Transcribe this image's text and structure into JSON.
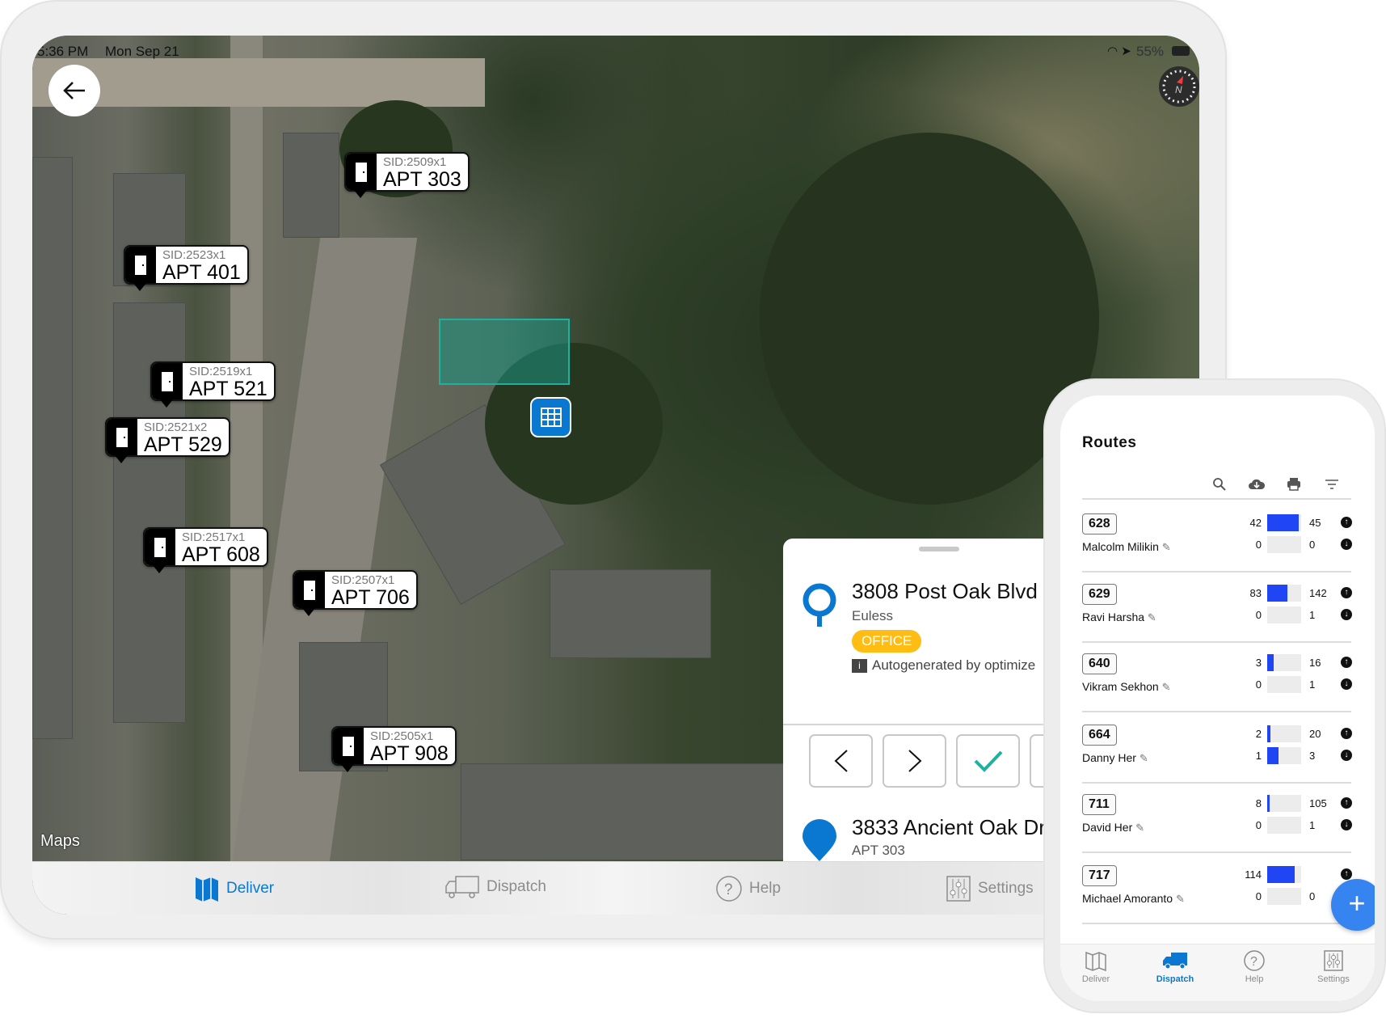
{
  "status_bar": {
    "time": "5:36 PM",
    "date": "Mon Sep 21",
    "battery": "55%"
  },
  "map": {
    "attribution": "Maps",
    "markers": [
      {
        "sid": "SID:2509x1",
        "apt": "APT 303"
      },
      {
        "sid": "SID:2523x1",
        "apt": "APT 401"
      },
      {
        "sid": "SID:2519x1",
        "apt": "APT 521"
      },
      {
        "sid": "SID:2521x2",
        "apt": "APT 529"
      },
      {
        "sid": "SID:2517x1",
        "apt": "APT 608"
      },
      {
        "sid": "SID:2507x1",
        "apt": "APT 706"
      },
      {
        "sid": "SID:2505x1",
        "apt": "APT 908"
      }
    ]
  },
  "sheet": {
    "stops": [
      {
        "title": "3808 Post Oak Blvd",
        "subtitle": "Euless",
        "tag": "OFFICE",
        "note": "Autogenerated by optimize"
      },
      {
        "title": "3833 Ancient Oak Dr",
        "subtitle": "APT 303"
      }
    ]
  },
  "tablet_nav": {
    "items": [
      {
        "label": "Deliver",
        "active": true
      },
      {
        "label": "Dispatch"
      },
      {
        "label": "Help"
      },
      {
        "label": "Settings"
      }
    ]
  },
  "phone": {
    "title": "Routes",
    "toolbar": [
      "search-icon",
      "cloud-download-icon",
      "print-icon",
      "filter-icon"
    ],
    "routes": [
      {
        "id": "628",
        "driver": "Malcolm Milikin",
        "up_done": 42,
        "up_total": 45,
        "down_done": 0,
        "down_total": 0
      },
      {
        "id": "629",
        "driver": "Ravi Harsha",
        "up_done": 83,
        "up_total": 142,
        "down_done": 0,
        "down_total": 1
      },
      {
        "id": "640",
        "driver": "Vikram Sekhon",
        "up_done": 3,
        "up_total": 16,
        "down_done": 0,
        "down_total": 1
      },
      {
        "id": "664",
        "driver": "Danny Her",
        "up_done": 2,
        "up_total": 20,
        "down_done": 1,
        "down_total": 3
      },
      {
        "id": "711",
        "driver": "David Her",
        "up_done": 8,
        "up_total": 105,
        "down_done": 0,
        "down_total": 1
      },
      {
        "id": "717",
        "driver": "Michael Amoranto",
        "up_done": 114,
        "up_total": null,
        "down_done": 0,
        "down_total": 0
      }
    ],
    "fab_label": "+",
    "nav": {
      "items": [
        {
          "label": "Deliver"
        },
        {
          "label": "Dispatch",
          "active": true
        },
        {
          "label": "Help"
        },
        {
          "label": "Settings"
        }
      ]
    }
  },
  "colors": {
    "accent": "#0a78d1",
    "bar_fill": "#1f45f5",
    "office_tag": "#ffbd14",
    "check": "#1fb0a0",
    "cross": "#e8434f",
    "fab": "#3584f0"
  }
}
